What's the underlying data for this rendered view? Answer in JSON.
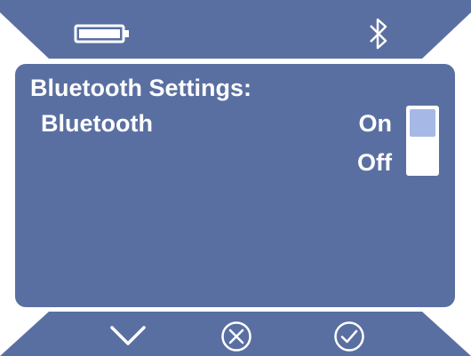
{
  "status_bar": {
    "battery_icon": "battery-icon",
    "bluetooth_icon": "bluetooth-icon"
  },
  "screen": {
    "title": "Bluetooth Settings:",
    "setting_label": "Bluetooth",
    "options": [
      "On",
      "Off"
    ],
    "selected_option": "On"
  },
  "nav": {
    "down_icon": "chevron-down-icon",
    "cancel_icon": "circle-x-icon",
    "confirm_icon": "circle-check-icon"
  },
  "colors": {
    "panel": "#5a6fa1",
    "toggle_knob": "#a6b9e6",
    "text": "#ffffff"
  }
}
